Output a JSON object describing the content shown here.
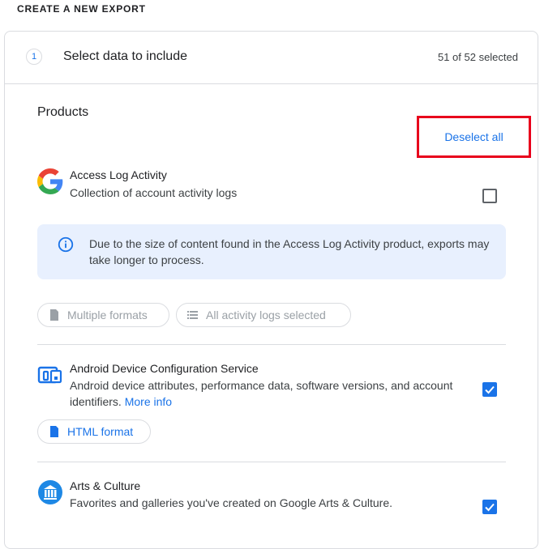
{
  "page": {
    "heading": "CREATE A NEW EXPORT"
  },
  "step": {
    "number": "1",
    "title": "Select data to include",
    "count": "51 of 52 selected"
  },
  "products_section": {
    "title": "Products",
    "deselect_label": "Deselect all"
  },
  "products": [
    {
      "name": "Access Log Activity",
      "description": "Collection of account activity logs",
      "checked": false,
      "icon": "google-g-icon",
      "info": "Due to the size of content found in the Access Log Activity product, exports may take longer to process.",
      "chips": [
        "Multiple formats",
        "All activity logs selected"
      ]
    },
    {
      "name": "Android Device Configuration Service",
      "description": "Android device attributes, performance data, software versions, and account identifiers.",
      "more_info": "More info",
      "checked": true,
      "icon": "devices-icon",
      "chips": [
        "HTML format"
      ]
    },
    {
      "name": "Arts & Culture",
      "description": "Favorites and galleries you've created on Google Arts & Culture.",
      "checked": true,
      "icon": "arts-culture-icon"
    }
  ],
  "colors": {
    "accent": "#1a73e8",
    "highlight": "#e8001c",
    "info_bg": "#e8f0fe"
  }
}
